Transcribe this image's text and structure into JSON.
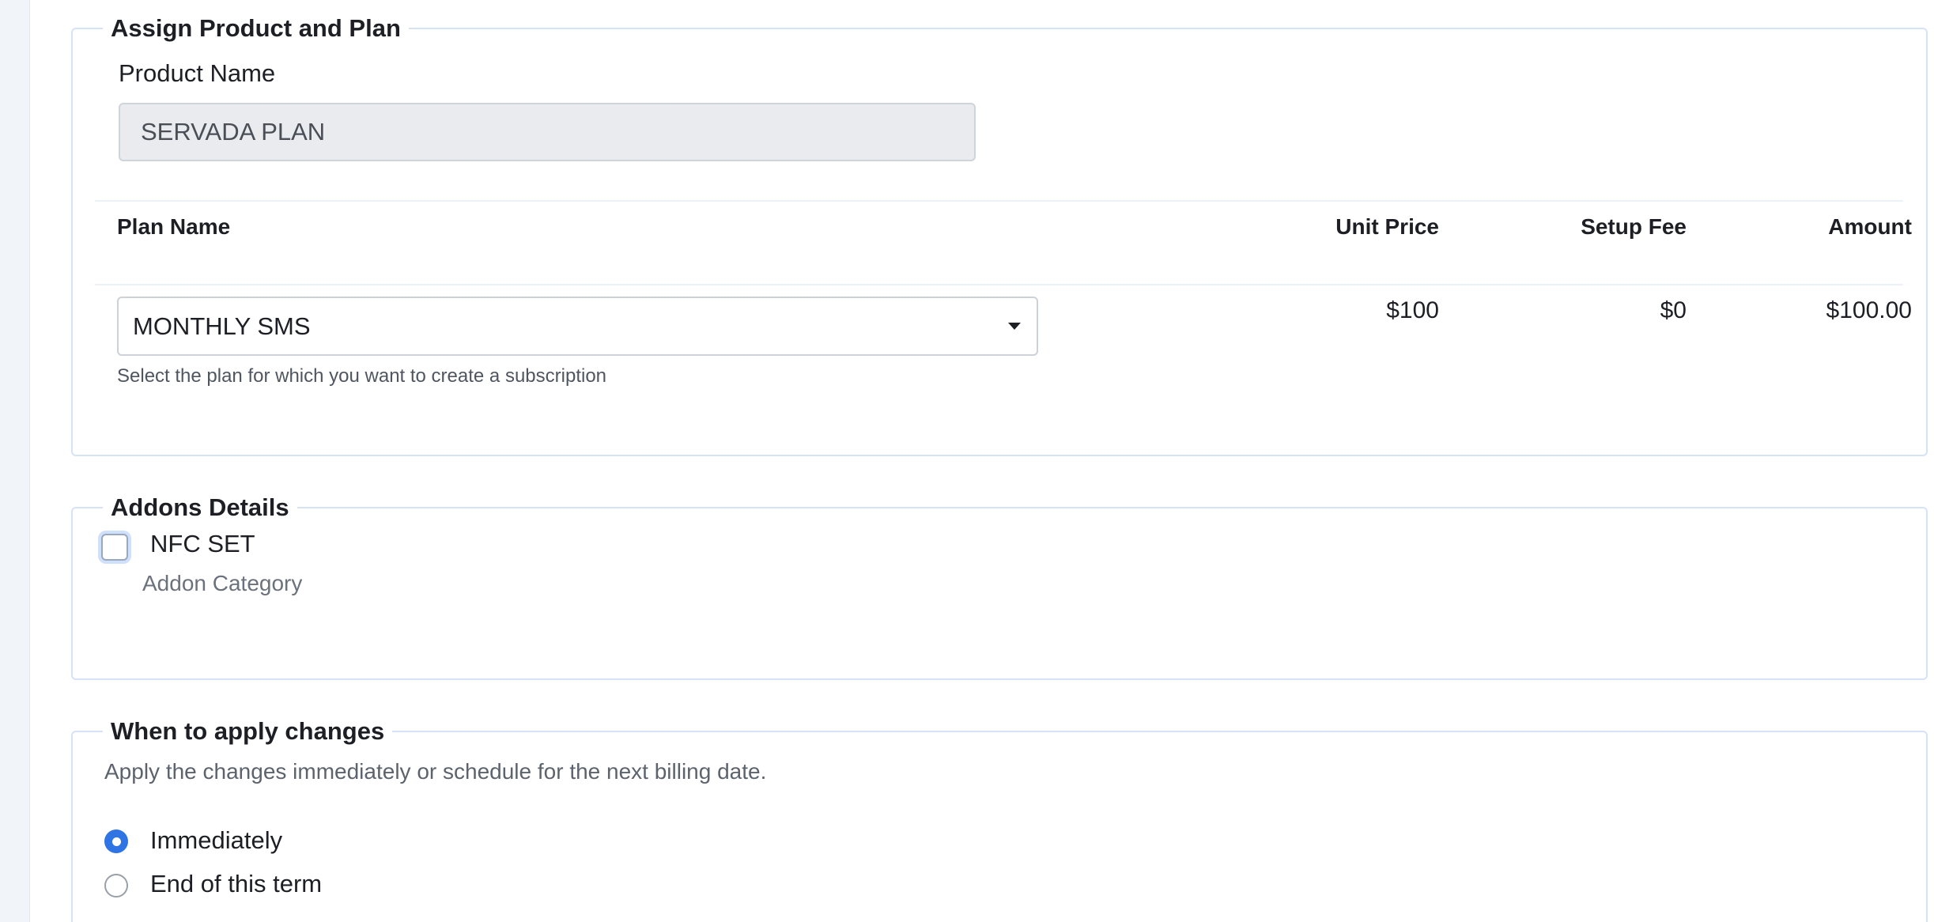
{
  "sections": {
    "plan": {
      "title": "Assign Product and Plan",
      "product_label": "Product Name",
      "product_value": "SERVADA PLAN",
      "columns": {
        "plan_name": "Plan Name",
        "unit_price": "Unit Price",
        "setup_fee": "Setup Fee",
        "amount": "Amount"
      },
      "row": {
        "plan_selected": "MONTHLY SMS",
        "unit_price": "$100",
        "setup_fee": "$0",
        "amount": "$100.00"
      },
      "helper": "Select the plan for which you want to create a subscription"
    },
    "addons": {
      "title": "Addons Details",
      "item_name": "NFC SET",
      "item_category": "Addon Category",
      "checked": false
    },
    "apply": {
      "title": "When to apply changes",
      "description": "Apply the changes immediately or schedule for the next billing date.",
      "options": [
        {
          "label": "Immediately",
          "checked": true
        },
        {
          "label": "End of this term",
          "checked": false
        }
      ]
    }
  },
  "colors": {
    "accent": "#2f74e4",
    "border": "#d6e2f5",
    "readonly_bg": "#e9ebee"
  }
}
